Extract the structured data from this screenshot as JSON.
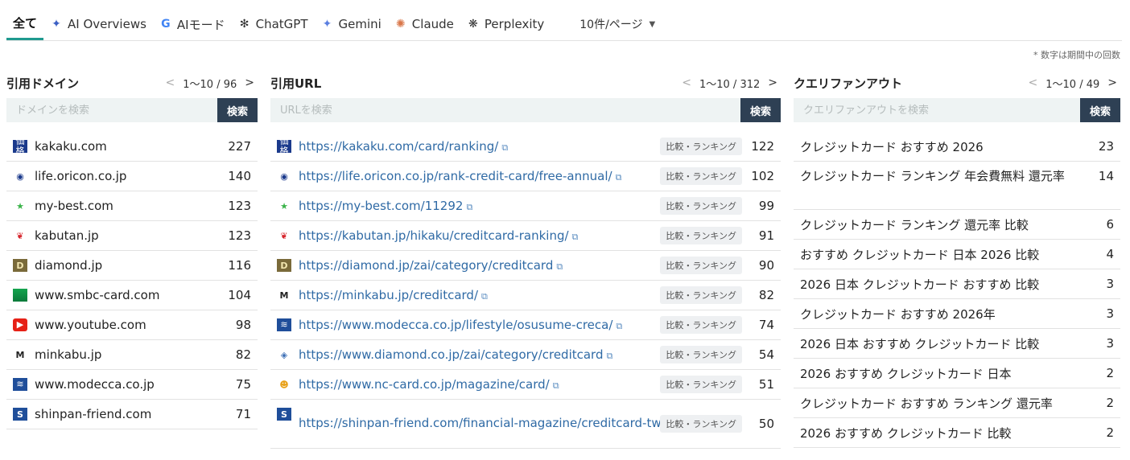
{
  "tabs": [
    {
      "label": "全て",
      "icon": "",
      "active": true
    },
    {
      "label": "AI Overviews",
      "icon": "sparkle-icon"
    },
    {
      "label": "AIモード",
      "icon": "google-icon"
    },
    {
      "label": "ChatGPT",
      "icon": "chatgpt-icon"
    },
    {
      "label": "Gemini",
      "icon": "gemini-icon"
    },
    {
      "label": "Claude",
      "icon": "claude-icon"
    },
    {
      "label": "Perplexity",
      "icon": "perplexity-icon"
    }
  ],
  "per_page": "10件/ページ",
  "note": "* 数字は期間中の回数",
  "search_label": "検索",
  "domains": {
    "title": "引用ドメイン",
    "pager": "1～10 / 96",
    "placeholder": "ドメインを検索",
    "rows": [
      {
        "name": "kakaku.com",
        "count": "227",
        "icon": "kakaku-favicon"
      },
      {
        "name": "life.oricon.co.jp",
        "count": "140",
        "icon": "oricon-favicon"
      },
      {
        "name": "my-best.com",
        "count": "123",
        "icon": "mybest-star-favicon"
      },
      {
        "name": "kabutan.jp",
        "count": "123",
        "icon": "kabutan-favicon"
      },
      {
        "name": "diamond.jp",
        "count": "116",
        "icon": "diamond-favicon"
      },
      {
        "name": "www.smbc-card.com",
        "count": "104",
        "icon": "smbc-favicon"
      },
      {
        "name": "www.youtube.com",
        "count": "98",
        "icon": "youtube-favicon"
      },
      {
        "name": "minkabu.jp",
        "count": "82",
        "icon": "minkabu-favicon"
      },
      {
        "name": "www.modecca.co.jp",
        "count": "75",
        "icon": "modecca-favicon"
      },
      {
        "name": "shinpan-friend.com",
        "count": "71",
        "icon": "shinpan-favicon"
      }
    ]
  },
  "urls": {
    "title": "引用URL",
    "pager": "1～10 / 312",
    "placeholder": "URLを検索",
    "badge": "比較・ランキング",
    "rows": [
      {
        "url": "https://kakaku.com/card/ranking/",
        "count": "122"
      },
      {
        "url": "https://life.oricon.co.jp/rank-credit-card/free-annual/",
        "count": "102"
      },
      {
        "url": "https://my-best.com/11292",
        "count": "99"
      },
      {
        "url": "https://kabutan.jp/hikaku/creditcard-ranking/",
        "count": "91"
      },
      {
        "url": "https://diamond.jp/zai/category/creditcard",
        "count": "90"
      },
      {
        "url": "https://minkabu.jp/creditcard/",
        "count": "82"
      },
      {
        "url": "https://www.modecca.co.jp/lifestyle/osusume-creca/",
        "count": "74"
      },
      {
        "url": "https://www.diamond.co.jp/zai/category/creditcard",
        "count": "54"
      },
      {
        "url": "https://www.nc-card.co.jp/magazine/card/",
        "count": "51"
      },
      {
        "url": "https://shinpan-friend.com/financial-magazine/creditcard-two/",
        "count": "50"
      }
    ]
  },
  "queries": {
    "title": "クエリファンアウト",
    "pager": "1～10 / 49",
    "placeholder": "クエリファンアウトを検索",
    "rows": [
      {
        "q": "クレジットカード おすすめ 2026",
        "count": "23"
      },
      {
        "q": "クレジットカード ランキング 年会費無料 還元率",
        "count": "14"
      },
      {
        "q": "クレジットカード ランキング 還元率 比較",
        "count": "6"
      },
      {
        "q": "おすすめ クレジットカード 日本 2026 比較",
        "count": "4"
      },
      {
        "q": "2026 日本 クレジットカード おすすめ 比較",
        "count": "3"
      },
      {
        "q": "クレジットカード おすすめ 2026年",
        "count": "3"
      },
      {
        "q": "2026 日本 おすすめ クレジットカード 比較",
        "count": "3"
      },
      {
        "q": "2026 おすすめ クレジットカード 日本",
        "count": "2"
      },
      {
        "q": "クレジットカード おすすめ ランキング 還元率",
        "count": "2"
      },
      {
        "q": "2026 おすすめ クレジットカード 比較",
        "count": "2"
      }
    ]
  }
}
